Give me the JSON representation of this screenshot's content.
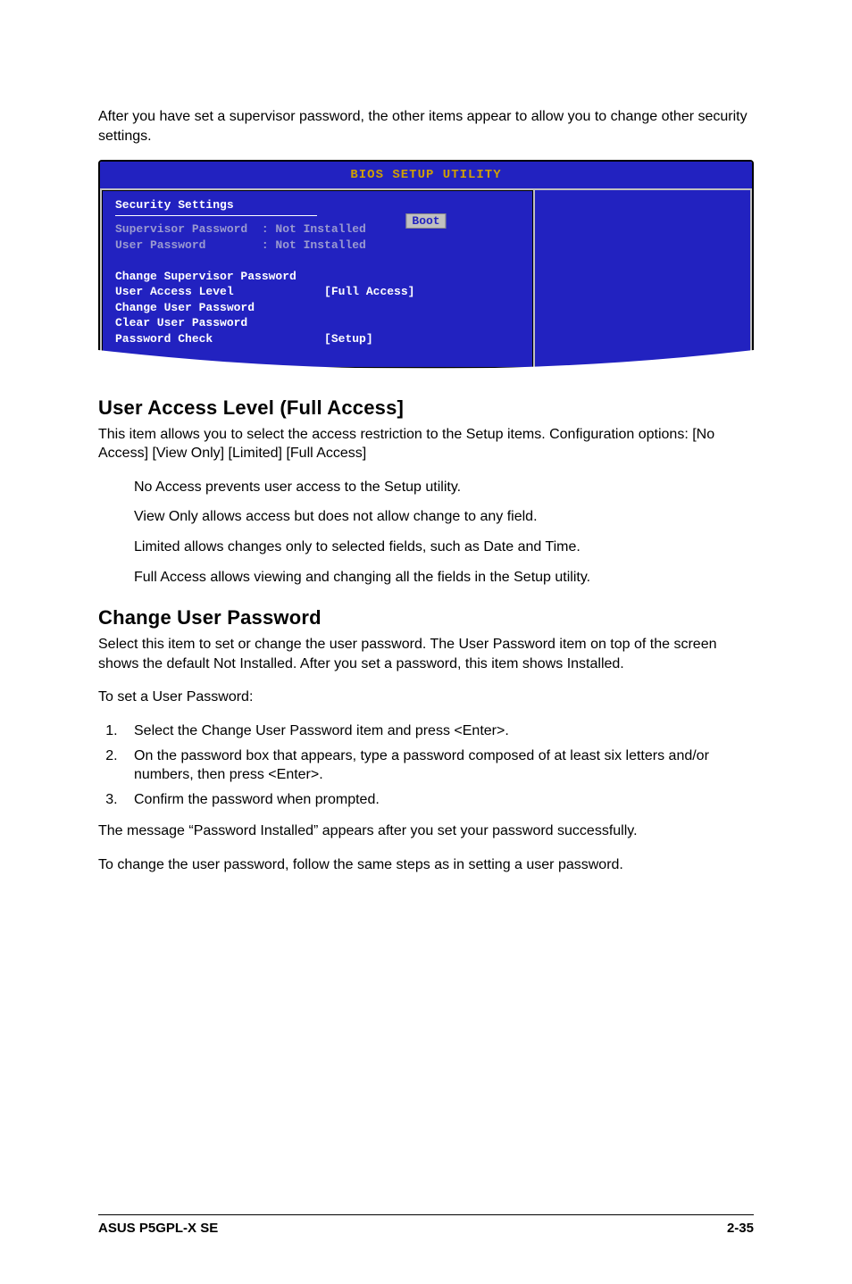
{
  "intro_para": "After you have set a supervisor password, the other items appear to allow you to change other security settings.",
  "bios": {
    "title": "BIOS SETUP UTILITY",
    "tab": "Boot",
    "section": "Security Settings",
    "lines": {
      "supervisor": "Supervisor Password  : Not Installed",
      "user": "User Password        : Not Installed",
      "blank1": " ",
      "chg_sup": "Change Supervisor Password",
      "ual": "User Access Level             [Full Access]",
      "chg_user": "Change User Password",
      "clr_user": "Clear User Password",
      "pw_check": "Password Check                [Setup]"
    }
  },
  "user_access": {
    "heading": "User Access Level (Full Access]",
    "desc": "This item allows you to select the access restriction to the Setup items. Configuration options: [No Access] [View Only] [Limited] [Full Access]",
    "no_access": "No Access prevents user access to the Setup utility.",
    "view_only": "View Only allows access but does not allow change to any field.",
    "limited": "Limited allows changes only to selected fields, such as Date and Time.",
    "full_access": "Full Access allows viewing and changing all the fields in the Setup utility."
  },
  "change_pw": {
    "heading": "Change User Password",
    "desc": "Select this item to set or change the user password. The User Password item on top of the screen shows the default Not Installed. After you set a password, this item shows Installed.",
    "to_set": "To set a User Password:",
    "steps": [
      "Select the Change User Password item and press <Enter>.",
      "On the password box that appears, type a password composed of at least six letters and/or numbers, then press <Enter>.",
      "Confirm the password when prompted."
    ],
    "success": "The message “Password Installed” appears after you set your password successfully.",
    "change": "To change the user password, follow the same steps as in setting a user password."
  },
  "footer": {
    "left": "ASUS P5GPL-X SE",
    "right": "2-35"
  }
}
